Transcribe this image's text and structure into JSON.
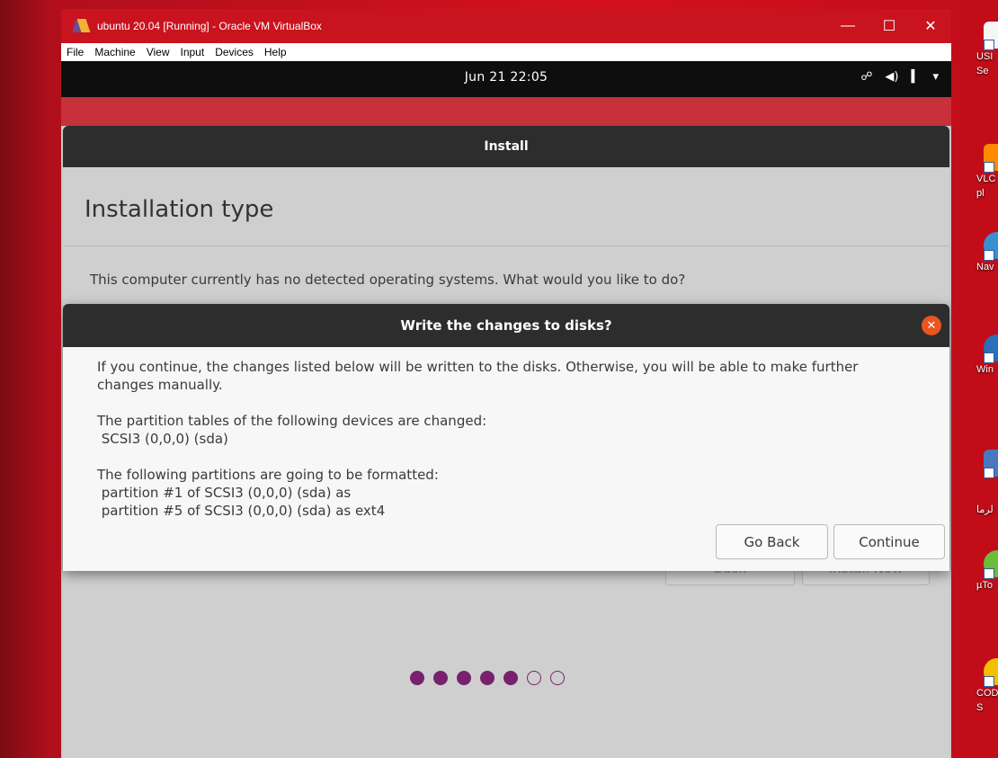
{
  "host": {
    "window_title": "ubuntu 20.04 [Running] - Oracle VM VirtualBox",
    "window_controls": {
      "minimize": "—",
      "maximize": "☐",
      "close": "✕"
    },
    "menu": [
      "File",
      "Machine",
      "View",
      "Input",
      "Devices",
      "Help"
    ],
    "desktop_icons": [
      {
        "label": "USI",
        "label2": "Se",
        "color": "#f5f5f5"
      },
      {
        "label": "VLC",
        "label2": "pl",
        "color": "#ff8a00"
      },
      {
        "label": "",
        "label2": "Nav",
        "color": "#3a8fd0"
      },
      {
        "label": "",
        "label2": "Win",
        "color": "#2a6fb8"
      },
      {
        "label": "",
        "label2": "لرما",
        "color": "#4a78c0"
      },
      {
        "label": "",
        "label2": "µTo",
        "color": "#6bbd3a"
      },
      {
        "label": "COD",
        "label2": "S",
        "color": "#f2c000"
      }
    ]
  },
  "guest": {
    "clock": "Jun 21  22:05",
    "tray_icons": [
      "network-icon",
      "volume-icon",
      "battery-icon",
      "dropdown-icon"
    ],
    "tray_glyphs": [
      "☍",
      "◀)",
      "▍",
      "▾"
    ]
  },
  "installer": {
    "window_title": "Install",
    "page_title": "Installation type",
    "question": "This computer currently has no detected operating systems. What would you like to do?",
    "back_label": "Back",
    "install_label": "Install Now",
    "progress": {
      "total": 7,
      "completed": 5
    }
  },
  "dialog": {
    "title": "Write the changes to disks?",
    "close_glyph": "✕",
    "intro_line1": "If you continue, the changes listed below will be written to the disks. Otherwise, you will be able to make further",
    "intro_line2": "changes manually.",
    "tables_heading": "The partition tables of the following devices are changed:",
    "tables_device": " SCSI3 (0,0,0) (sda)",
    "format_heading": "The following partitions are going to be formatted:",
    "format_item1": " partition #1 of SCSI3 (0,0,0) (sda) as",
    "format_item2": " partition #5 of SCSI3 (0,0,0) (sda) as ext4",
    "go_back_label": "Go Back",
    "continue_label": "Continue"
  }
}
